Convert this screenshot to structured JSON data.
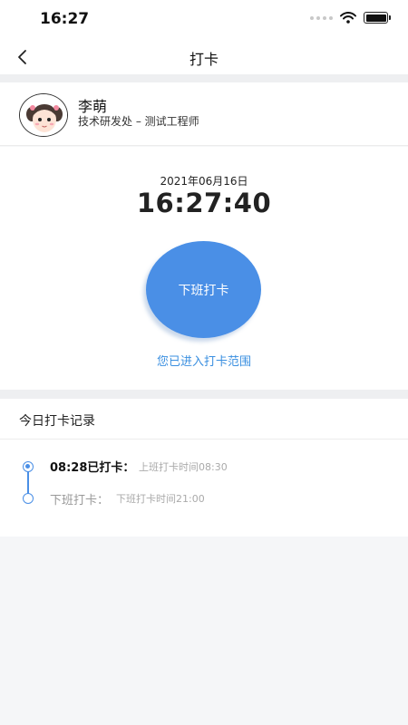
{
  "status_bar": {
    "time": "16:27",
    "icons": [
      "signal-dots-icon",
      "wifi-icon",
      "battery-icon"
    ]
  },
  "nav": {
    "title": "打卡",
    "back_icon": "chevron-left-icon"
  },
  "user": {
    "name": "李萌",
    "department": "技术研发处 – 测试工程师",
    "avatar_icon": "girl-avatar-icon"
  },
  "punch": {
    "date": "2021年06月16日",
    "time": "16:27:40",
    "button_label": "下班打卡",
    "range_status": "您已进入打卡范围"
  },
  "records": {
    "title": "今日打卡记录",
    "items": [
      {
        "main": "08:28已打卡：",
        "note": "上班打卡时间08:30",
        "done": true
      },
      {
        "main": "下班打卡：",
        "note": "下班打卡时间21:00",
        "done": false
      }
    ]
  },
  "colors": {
    "accent": "#4a8fe6",
    "link": "#3a8fe0",
    "muted": "#aaaaaa",
    "page_bg": "#f5f6f8"
  }
}
